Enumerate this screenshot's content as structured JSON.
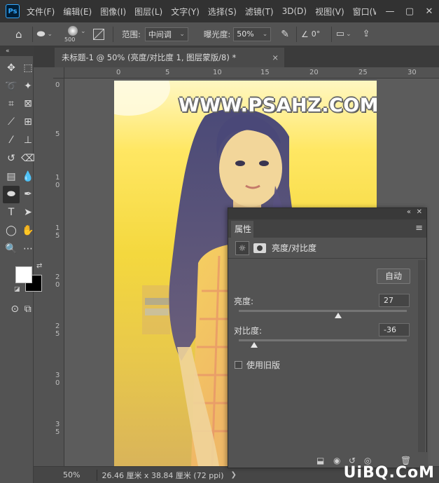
{
  "app": {
    "logo": "Ps"
  },
  "menu": [
    "文件(F)",
    "编辑(E)",
    "图像(I)",
    "图层(L)",
    "文字(Y)",
    "选择(S)",
    "滤镜(T)",
    "3D(D)",
    "视图(V)",
    "窗口(W"
  ],
  "window_controls": {
    "minimize": "—",
    "maximize": "▢",
    "close": "✕"
  },
  "options": {
    "brush_size": "500",
    "range_label": "范围:",
    "range_value": "中间调",
    "exposure_label": "曝光度:",
    "exposure_value": "50%",
    "angle_value": "0°"
  },
  "document": {
    "tab_title": "未标题-1 @ 50% (亮度/对比度 1, 图层蒙版/8) *",
    "close": "×"
  },
  "ruler": {
    "top": [
      "0",
      "5",
      "10",
      "15",
      "20",
      "25",
      "30"
    ],
    "left": [
      "0",
      "5",
      "1 0",
      "1 5",
      "2 0",
      "2 5",
      "3 0",
      "3 5"
    ]
  },
  "canvas": {
    "watermark": "WWW.PSAHZ.COM"
  },
  "status": {
    "zoom": "50%",
    "doc_size": "26.46 厘米 x 38.84 厘米 (72 ppi)"
  },
  "properties": {
    "tab": "属性",
    "collapse": "«",
    "close": "✕",
    "menu": "≡",
    "title": "亮度/对比度",
    "auto": "自动",
    "brightness_label": "亮度:",
    "brightness_value": "27",
    "contrast_label": "对比度:",
    "contrast_value": "-36",
    "legacy_label": "使用旧版",
    "brightness": 27,
    "contrast": -36
  },
  "site_watermark": "UiBQ.CoM"
}
